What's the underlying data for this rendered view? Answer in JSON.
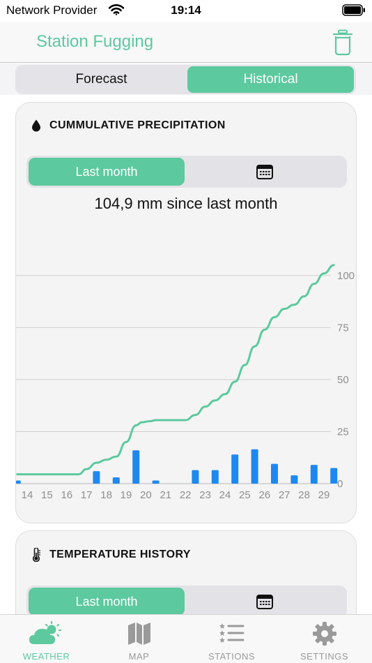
{
  "status": {
    "carrier": "Network Provider",
    "time": "19:14"
  },
  "nav": {
    "title": "Station Fugging",
    "trash_icon": "trash-icon"
  },
  "segments": {
    "forecast": "Forecast",
    "historical": "Historical",
    "selected": "Historical"
  },
  "colors": {
    "accent": "#5cc99f",
    "bar": "#1e88f0",
    "grid": "#cfcfcf"
  },
  "precipitation_card": {
    "title": "CUMMULATIVE PRECIPITATION",
    "icon": "water-drop-icon",
    "range_label": "Last month",
    "calendar_icon": "calendar-icon",
    "summary": "104,9 mm since last month"
  },
  "temperature_card": {
    "title": "TEMPERATURE HISTORY",
    "icon": "thermometer-icon",
    "range_label": "Last month",
    "calendar_icon": "calendar-icon"
  },
  "tabs": [
    {
      "label": "WEATHER",
      "icon": "weather-icon",
      "active": true
    },
    {
      "label": "MAP",
      "icon": "map-icon",
      "active": false
    },
    {
      "label": "STATIONS",
      "icon": "list-icon",
      "active": false
    },
    {
      "label": "SETTINGS",
      "icon": "gear-icon",
      "active": false
    }
  ],
  "chart_data": {
    "type": "bar",
    "title": "",
    "categories": [
      "14",
      "15",
      "16",
      "17",
      "18",
      "19",
      "20",
      "21",
      "22",
      "23",
      "24",
      "25",
      "26",
      "27",
      "28",
      "29"
    ],
    "y_ticks": [
      0,
      25,
      50,
      75,
      100
    ],
    "ylim": [
      0,
      110
    ],
    "grid": true,
    "series": [
      {
        "type": "bar",
        "x": [
          13.5,
          17.5,
          18.5,
          19.5,
          20.5,
          22.5,
          23.5,
          24.5,
          25.5,
          26.5,
          27.5,
          28.5,
          29.5
        ],
        "values": [
          1.5,
          6,
          3,
          16,
          1.5,
          6.5,
          6.5,
          14,
          16.5,
          9.5,
          4,
          9,
          7.5
        ]
      },
      {
        "type": "line",
        "x": [
          13.5,
          14,
          15,
          16,
          16.6,
          17,
          17.5,
          18,
          18.5,
          19,
          19.5,
          19.8,
          20.2,
          20.5,
          21,
          21.5,
          22,
          22.5,
          23,
          23.5,
          24,
          24.5,
          25,
          25.5,
          26,
          26.5,
          27,
          27.5,
          28,
          28.5,
          29,
          29.5
        ],
        "values": [
          4.5,
          4.5,
          4.5,
          4.5,
          4.5,
          7,
          10,
          11.5,
          13,
          20,
          28,
          29.5,
          30,
          30.5,
          30.5,
          30.5,
          30.5,
          33,
          37,
          40,
          43,
          49,
          57,
          66,
          74,
          80,
          84,
          86,
          90,
          96,
          101,
          105
        ]
      }
    ]
  }
}
